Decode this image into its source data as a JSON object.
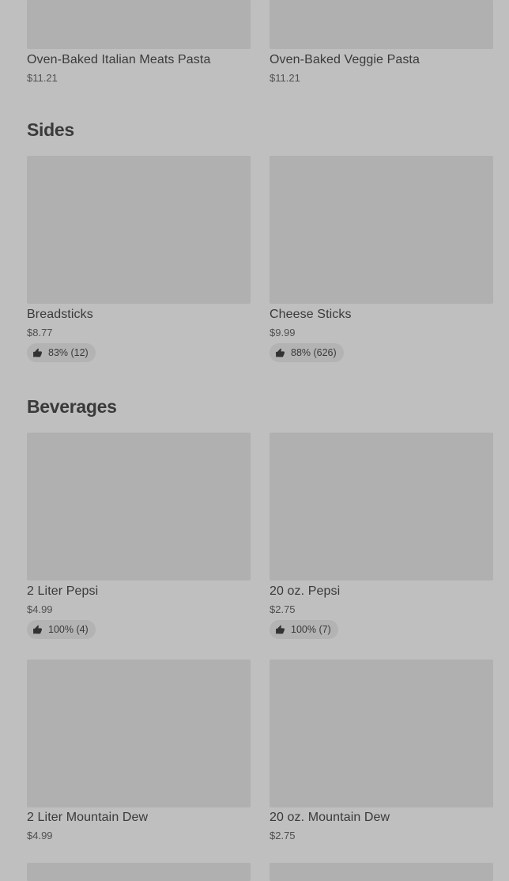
{
  "top_items": [
    {
      "name": "Oven-Baked Italian Meats Pasta",
      "price": "$11.21"
    },
    {
      "name": "Oven-Baked Veggie Pasta",
      "price": "$11.21"
    }
  ],
  "sides": {
    "title": "Sides",
    "items": [
      {
        "name": "Breadsticks",
        "price": "$8.77",
        "rating": "83% (12)"
      },
      {
        "name": "Cheese Sticks",
        "price": "$9.99",
        "rating": "88% (626)"
      }
    ]
  },
  "beverages": {
    "title": "Beverages",
    "items": [
      {
        "name": "2 Liter Pepsi",
        "price": "$4.99",
        "rating": "100% (4)"
      },
      {
        "name": "20 oz. Pepsi",
        "price": "$2.75",
        "rating": "100% (7)"
      },
      {
        "name": "2 Liter Mountain Dew",
        "price": "$4.99"
      },
      {
        "name": "20 oz. Mountain Dew",
        "price": "$2.75"
      }
    ]
  },
  "icons": {
    "rating": "thumbs-up-icon"
  },
  "colors": {
    "background": "#bfbfbf",
    "image_placeholder": "#b0b0b0",
    "rating_pill": "#b3b3b3",
    "text": "#3a3a3a"
  }
}
